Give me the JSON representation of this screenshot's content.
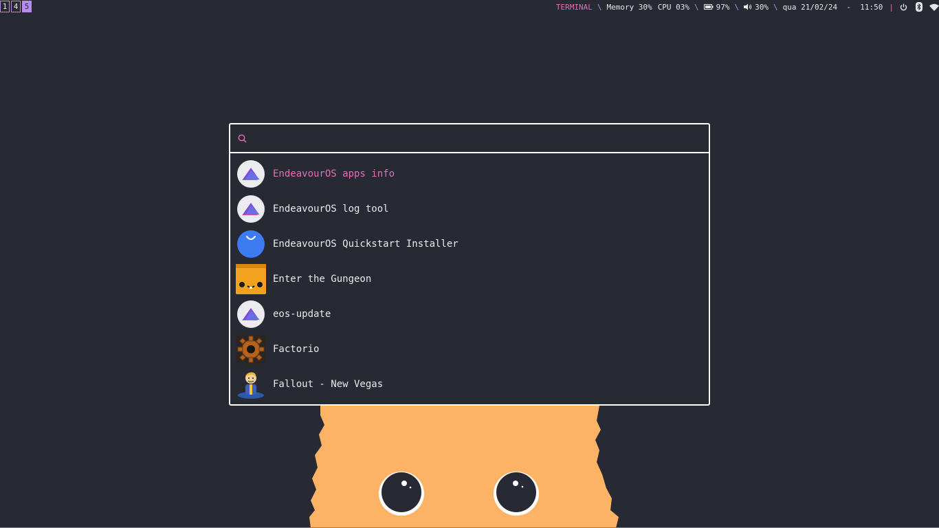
{
  "workspaces": [
    {
      "label": "1",
      "active": false
    },
    {
      "label": "4",
      "active": false
    },
    {
      "label": "5",
      "active": true
    }
  ],
  "status": {
    "mode": "TERMINAL",
    "separator": "\\",
    "memory": "Memory 30%",
    "cpu": "CPU 03%",
    "battery": "97%",
    "volume": "30%",
    "datetime": "qua 21/02/24  -  11:50",
    "pipe": "|",
    "icons": [
      "battery-icon",
      "volume-icon",
      "power-icon",
      "bluetooth-icon",
      "wifi-icon"
    ]
  },
  "launcher": {
    "search": {
      "value": "",
      "placeholder": "",
      "icon": "search-icon"
    },
    "items": [
      {
        "label": "EndeavourOS apps info",
        "icon": "endeavouros-icon",
        "selected": true
      },
      {
        "label": "EndeavourOS log tool",
        "icon": "endeavouros-icon",
        "selected": false
      },
      {
        "label": "EndeavourOS Quickstart Installer",
        "icon": "quickstart-installer-icon",
        "selected": false
      },
      {
        "label": "Enter the Gungeon",
        "icon": "gungeon-icon",
        "selected": false
      },
      {
        "label": "eos-update",
        "icon": "endeavouros-icon",
        "selected": false
      },
      {
        "label": "Factorio",
        "icon": "factorio-gear-icon",
        "selected": false
      },
      {
        "label": "Fallout - New Vegas",
        "icon": "vault-boy-icon",
        "selected": false
      }
    ]
  },
  "colors": {
    "background": "#282a33",
    "accent_pink": "#e86bb8",
    "accent_purple": "#b58cf0",
    "border": "#ffffff",
    "cat_orange": "#fdb366"
  }
}
